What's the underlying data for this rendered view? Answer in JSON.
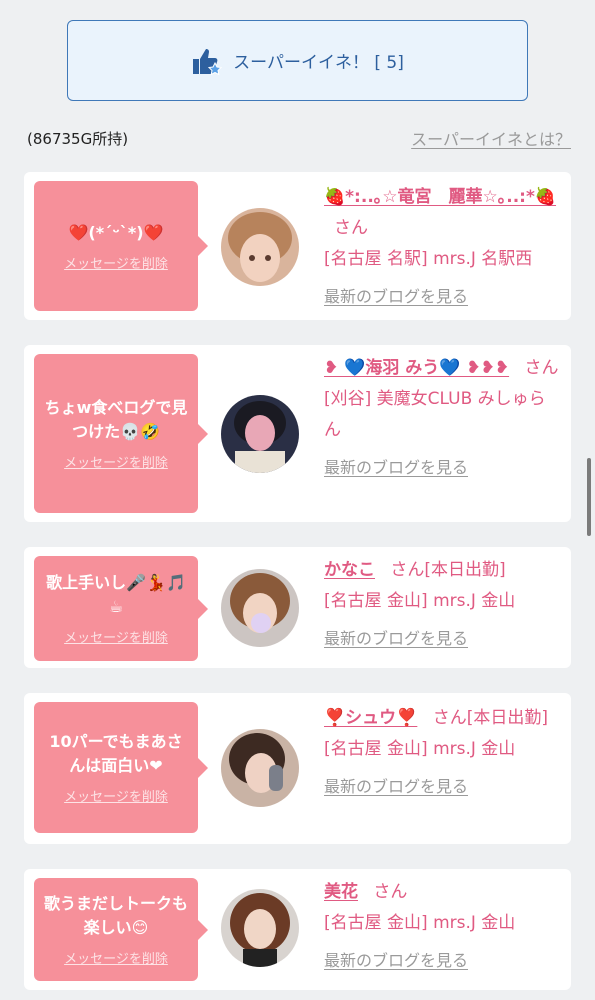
{
  "super_button": {
    "label": "スーパーイイネ！ [ 5]"
  },
  "points": "(86735G所持)",
  "about_link": "スーパーイイネとは？",
  "delete_label": "メッセージを削除",
  "blog_label": "最新のブログを見る",
  "san_label": "さん",
  "colors": {
    "accent_blue": "#3f78b8",
    "bubble_pink": "#f6909a",
    "name_pink": "#e05a82",
    "gray_link": "#9a9a9a"
  },
  "cards": [
    {
      "message": "❤️(*´ᵕ`*)❤️",
      "name": "🍓*:..｡☆竜宮　麗華☆｡..:*🍓",
      "status": "",
      "shop": "[名古屋 名駅] mrs.J 名駅西"
    },
    {
      "message": "ちょw食べログで見つけた💀🤣",
      "name": "❥ 💙海羽 みう💙 ❥❥❥",
      "status": "",
      "shop": "[刈谷] 美魔女CLUB みしゅらん"
    },
    {
      "message": "歌上手いし🎤💃🎵☕",
      "name": "かなこ",
      "status": "[本日出勤]",
      "shop": "[名古屋 金山] mrs.J 金山"
    },
    {
      "message": "10パーでもまあさんは面白い❤",
      "name": "❣️シュウ❣️",
      "status": "[本日出勤]",
      "shop": "[名古屋 金山] mrs.J 金山"
    },
    {
      "message": "歌うまだしトークも楽しい😊",
      "name": "美花",
      "status": "",
      "shop": "[名古屋 金山] mrs.J 金山"
    }
  ]
}
